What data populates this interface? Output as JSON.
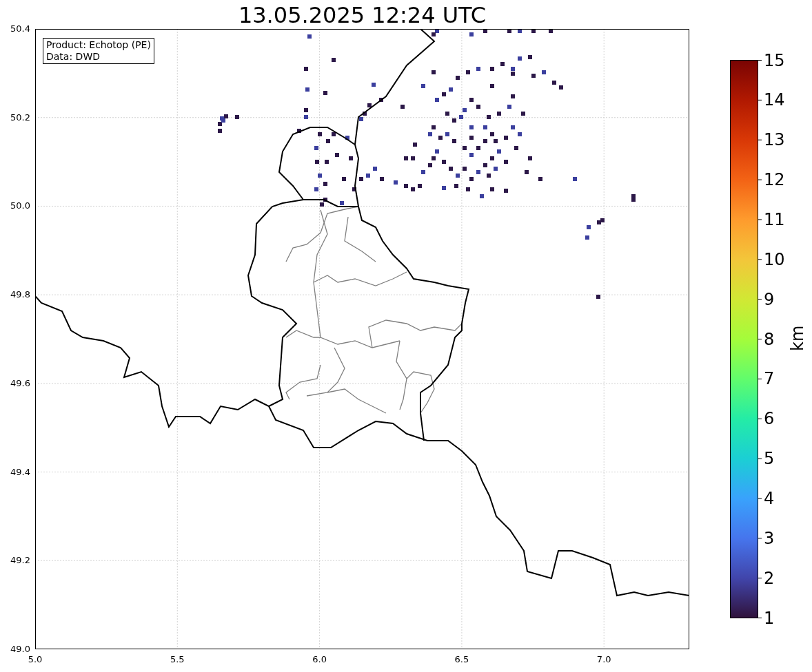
{
  "title": "13.05.2025 12:24 UTC",
  "info_box": {
    "lines": [
      "Product: Echotop (PE)",
      "Data: DWD"
    ]
  },
  "map": {
    "x_ticks": [
      "5.0",
      "5.5",
      "6.0",
      "6.5",
      "7.0"
    ],
    "y_ticks": [
      "50.4",
      "50.2",
      "50.0",
      "49.8",
      "49.6",
      "49.4",
      "49.2",
      "49.0"
    ]
  },
  "colorbar": {
    "label": "km",
    "ticks": [
      "15",
      "14",
      "13",
      "12",
      "11",
      "10",
      "9",
      "8",
      "7",
      "6",
      "5",
      "4",
      "3",
      "2",
      "1"
    ]
  }
}
